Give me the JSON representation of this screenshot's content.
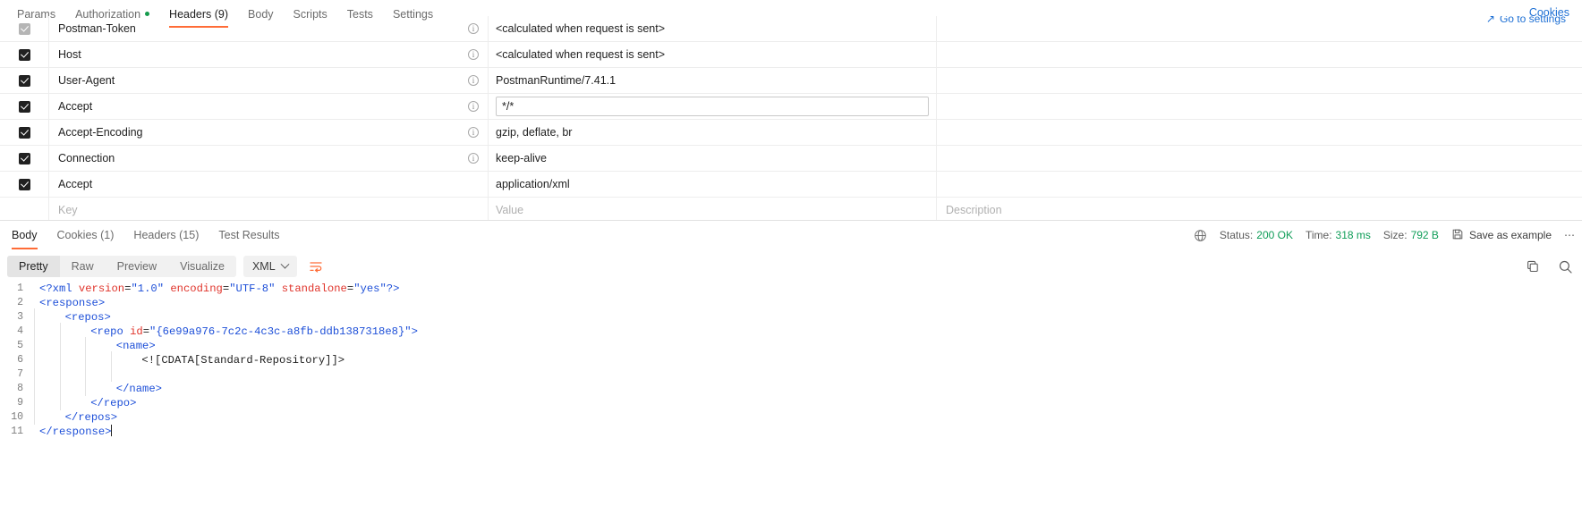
{
  "request_tabs": [
    {
      "label": "Params",
      "active": false,
      "dot": false
    },
    {
      "label": "Authorization",
      "active": false,
      "dot": true
    },
    {
      "label": "Headers (9)",
      "active": true,
      "dot": false
    },
    {
      "label": "Body",
      "active": false,
      "dot": false
    },
    {
      "label": "Scripts",
      "active": false,
      "dot": false
    },
    {
      "label": "Tests",
      "active": false,
      "dot": false
    },
    {
      "label": "Settings",
      "active": false,
      "dot": false
    }
  ],
  "cookies_link": "Cookies",
  "go_to_settings": "Go to settings",
  "headers_table": {
    "placeholders": {
      "key": "Key",
      "value": "Value",
      "description": "Description"
    },
    "info_glyph": "i",
    "rows": [
      {
        "checked": true,
        "muted": true,
        "key": "Postman-Token",
        "value": "<calculated when request is sent>",
        "info": true,
        "focused": false
      },
      {
        "checked": true,
        "muted": false,
        "key": "Host",
        "value": "<calculated when request is sent>",
        "info": true,
        "focused": false
      },
      {
        "checked": true,
        "muted": false,
        "key": "User-Agent",
        "value": "PostmanRuntime/7.41.1",
        "info": true,
        "focused": false
      },
      {
        "checked": true,
        "muted": false,
        "key": "Accept",
        "value": "*/*",
        "info": true,
        "focused": true
      },
      {
        "checked": true,
        "muted": false,
        "key": "Accept-Encoding",
        "value": "gzip, deflate, br",
        "info": true,
        "focused": false
      },
      {
        "checked": true,
        "muted": false,
        "key": "Connection",
        "value": "keep-alive",
        "info": true,
        "focused": false
      },
      {
        "checked": true,
        "muted": false,
        "key": "Accept",
        "value": "application/xml",
        "info": false,
        "focused": false
      }
    ]
  },
  "response": {
    "tabs": [
      {
        "label": "Body",
        "active": true
      },
      {
        "label": "Cookies (1)",
        "active": false
      },
      {
        "label": "Headers (15)",
        "active": false
      },
      {
        "label": "Test Results",
        "active": false
      }
    ],
    "meta": {
      "status_label": "Status:",
      "status_value": "200 OK",
      "time_label": "Time:",
      "time_value": "318 ms",
      "size_label": "Size:",
      "size_value": "792 B",
      "save_as_example": "Save as example",
      "overflow": "⋯"
    },
    "format_tabs": [
      {
        "label": "Pretty",
        "active": true
      },
      {
        "label": "Raw",
        "active": false
      },
      {
        "label": "Preview",
        "active": false
      },
      {
        "label": "Visualize",
        "active": false
      }
    ],
    "language": "XML",
    "code_lines": [
      {
        "n": 1,
        "indent": 0,
        "tokens": [
          {
            "t": "<?xml",
            "c": "tg"
          },
          {
            "t": " ",
            "c": "pl"
          },
          {
            "t": "version",
            "c": "at"
          },
          {
            "t": "=",
            "c": "pl"
          },
          {
            "t": "\"1.0\"",
            "c": "st"
          },
          {
            "t": " ",
            "c": "pl"
          },
          {
            "t": "encoding",
            "c": "at"
          },
          {
            "t": "=",
            "c": "pl"
          },
          {
            "t": "\"UTF-8\"",
            "c": "st"
          },
          {
            "t": " ",
            "c": "pl"
          },
          {
            "t": "standalone",
            "c": "at"
          },
          {
            "t": "=",
            "c": "pl"
          },
          {
            "t": "\"yes\"",
            "c": "st"
          },
          {
            "t": "?>",
            "c": "tg"
          }
        ]
      },
      {
        "n": 2,
        "indent": 0,
        "tokens": [
          {
            "t": "<response>",
            "c": "tg"
          }
        ]
      },
      {
        "n": 3,
        "indent": 1,
        "tokens": [
          {
            "t": "<repos>",
            "c": "tg"
          }
        ]
      },
      {
        "n": 4,
        "indent": 2,
        "tokens": [
          {
            "t": "<repo ",
            "c": "tg"
          },
          {
            "t": "id",
            "c": "at"
          },
          {
            "t": "=",
            "c": "pl"
          },
          {
            "t": "\"{6e99a976-7c2c-4c3c-a8fb-ddb1387318e8}\"",
            "c": "st"
          },
          {
            "t": ">",
            "c": "tg"
          }
        ]
      },
      {
        "n": 5,
        "indent": 3,
        "tokens": [
          {
            "t": "<name>",
            "c": "tg"
          }
        ]
      },
      {
        "n": 6,
        "indent": 4,
        "tokens": [
          {
            "t": "<![CDATA[Standard-Repository]]>",
            "c": "cd"
          }
        ]
      },
      {
        "n": 7,
        "indent": 4,
        "tokens": []
      },
      {
        "n": 8,
        "indent": 3,
        "tokens": [
          {
            "t": "</name>",
            "c": "tg"
          }
        ]
      },
      {
        "n": 9,
        "indent": 2,
        "tokens": [
          {
            "t": "</repo>",
            "c": "tg"
          }
        ]
      },
      {
        "n": 10,
        "indent": 1,
        "tokens": [
          {
            "t": "</repos>",
            "c": "tg"
          }
        ]
      },
      {
        "n": 11,
        "indent": 0,
        "tokens": [
          {
            "t": "</response>",
            "c": "tg"
          }
        ],
        "caret": true
      }
    ]
  },
  "colors": {
    "accent": "#ff6c37",
    "link": "#1d6fd4",
    "success": "#0f9d58",
    "tag": "#1d4fd8",
    "attr": "#e0342b"
  }
}
